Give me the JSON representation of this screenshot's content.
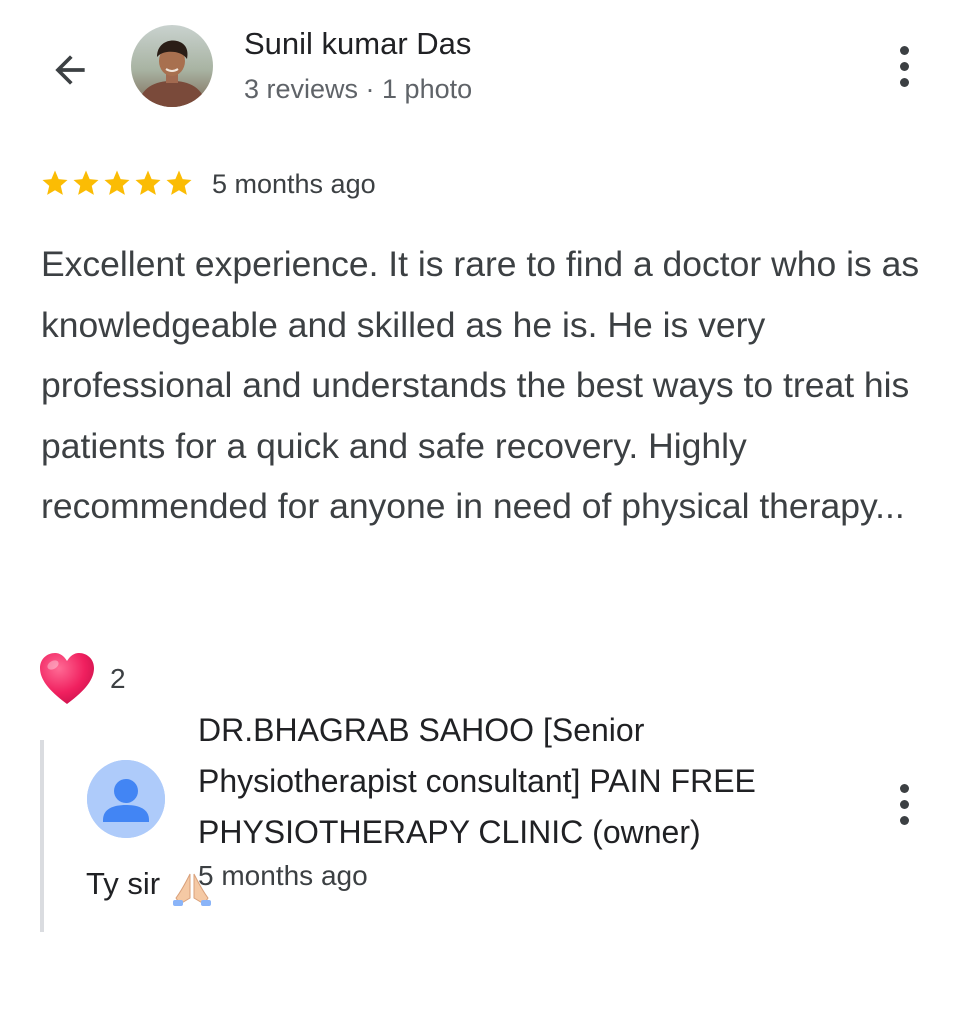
{
  "header": {
    "back_icon": "arrow-back-icon",
    "reviewer_name": "Sunil kumar Das",
    "reviewer_meta": "3 reviews · 1 photo",
    "more_icon": "more-vertical-icon"
  },
  "review": {
    "rating": 5,
    "rating_max": 5,
    "star_color": "#fbbc04",
    "time": "5 months ago",
    "text": "Excellent experience. It is rare to find a doctor who is as knowledgeable and skilled as he is. He is very professional and understands the best ways to treat his patients for a quick and safe recovery. Highly recommended for anyone in need of physical therapy..."
  },
  "reactions": {
    "icon": "heart-icon",
    "count": "2"
  },
  "owner_reply": {
    "avatar_icon": "default-person-avatar-icon",
    "name": "DR.BHAGRAB SAHOO [Senior Physiotherapist consultant] PAIN FREE PHYSIOTHERAPY CLINIC (owner)",
    "text": "Ty sir",
    "emoji": "folded-hands-icon",
    "time": "5 months ago",
    "more_icon": "more-vertical-icon"
  }
}
